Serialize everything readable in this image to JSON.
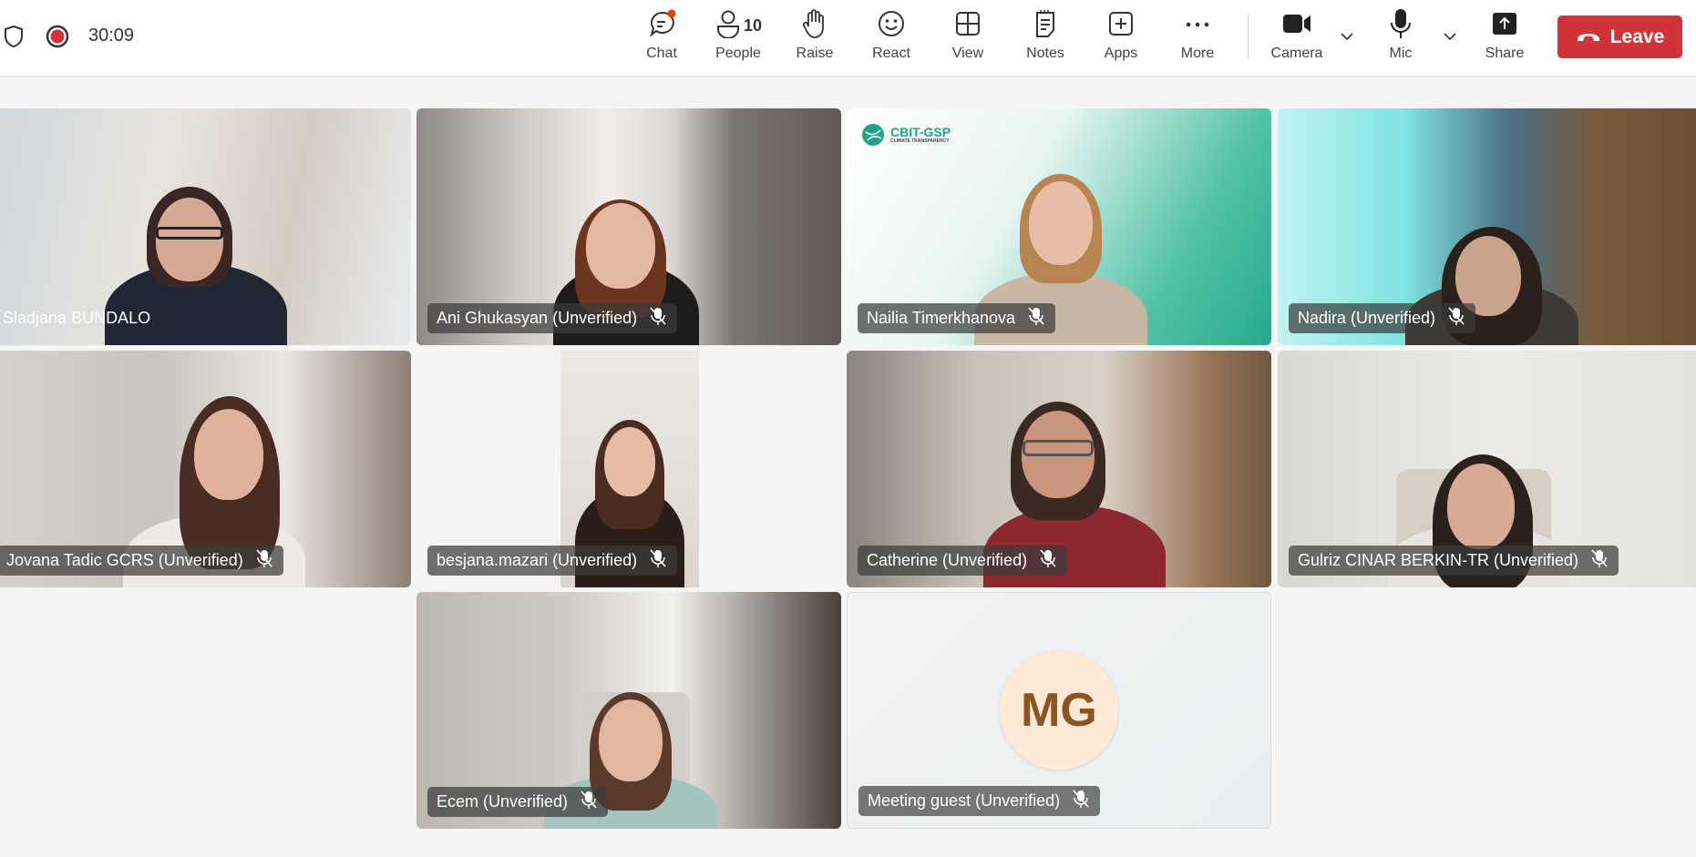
{
  "header": {
    "timer": "30:09",
    "recording": true,
    "toolbar": [
      {
        "id": "chat",
        "label": "Chat",
        "icon": "chat-icon",
        "badge_dot": true
      },
      {
        "id": "people",
        "label": "People",
        "icon": "people-icon",
        "count": "10"
      },
      {
        "id": "raise",
        "label": "Raise",
        "icon": "raise-hand-icon"
      },
      {
        "id": "react",
        "label": "React",
        "icon": "smiley-icon"
      },
      {
        "id": "view",
        "label": "View",
        "icon": "grid-view-icon"
      },
      {
        "id": "notes",
        "label": "Notes",
        "icon": "notes-icon"
      },
      {
        "id": "apps",
        "label": "Apps",
        "icon": "plus-square-icon"
      },
      {
        "id": "more",
        "label": "More",
        "icon": "more-dots-icon"
      },
      {
        "id": "camera",
        "label": "Camera",
        "icon": "camera-icon"
      },
      {
        "id": "mic",
        "label": "Mic",
        "icon": "mic-icon"
      },
      {
        "id": "share",
        "label": "Share",
        "icon": "share-icon"
      }
    ],
    "leave_label": "Leave",
    "leave_color": "#d13438"
  },
  "participants": [
    {
      "name": "Sladjana BUNDALO",
      "muted": false
    },
    {
      "name": "Ani Ghukasyan (Unverified)",
      "muted": true
    },
    {
      "name": "Nailia Timerkhanova",
      "muted": true,
      "background_logo": "CBIT-GSP",
      "background_logo_sub": "CLIMATE TRANSPARENCY"
    },
    {
      "name": "Nadira (Unverified)",
      "muted": true
    },
    {
      "name": "Jovana Tadic GCRS (Unverified)",
      "muted": true
    },
    {
      "name": "besjana.mazari (Unverified)",
      "muted": true
    },
    {
      "name": "Catherine (Unverified)",
      "muted": true
    },
    {
      "name": "Gulriz CINAR BERKIN-TR (Unverified)",
      "muted": true
    },
    {
      "name": "Ecem (Unverified)",
      "muted": true
    },
    {
      "name": "Meeting guest (Unverified)",
      "muted": true,
      "initials": "MG",
      "avatar_color": "#fde9d6"
    }
  ]
}
